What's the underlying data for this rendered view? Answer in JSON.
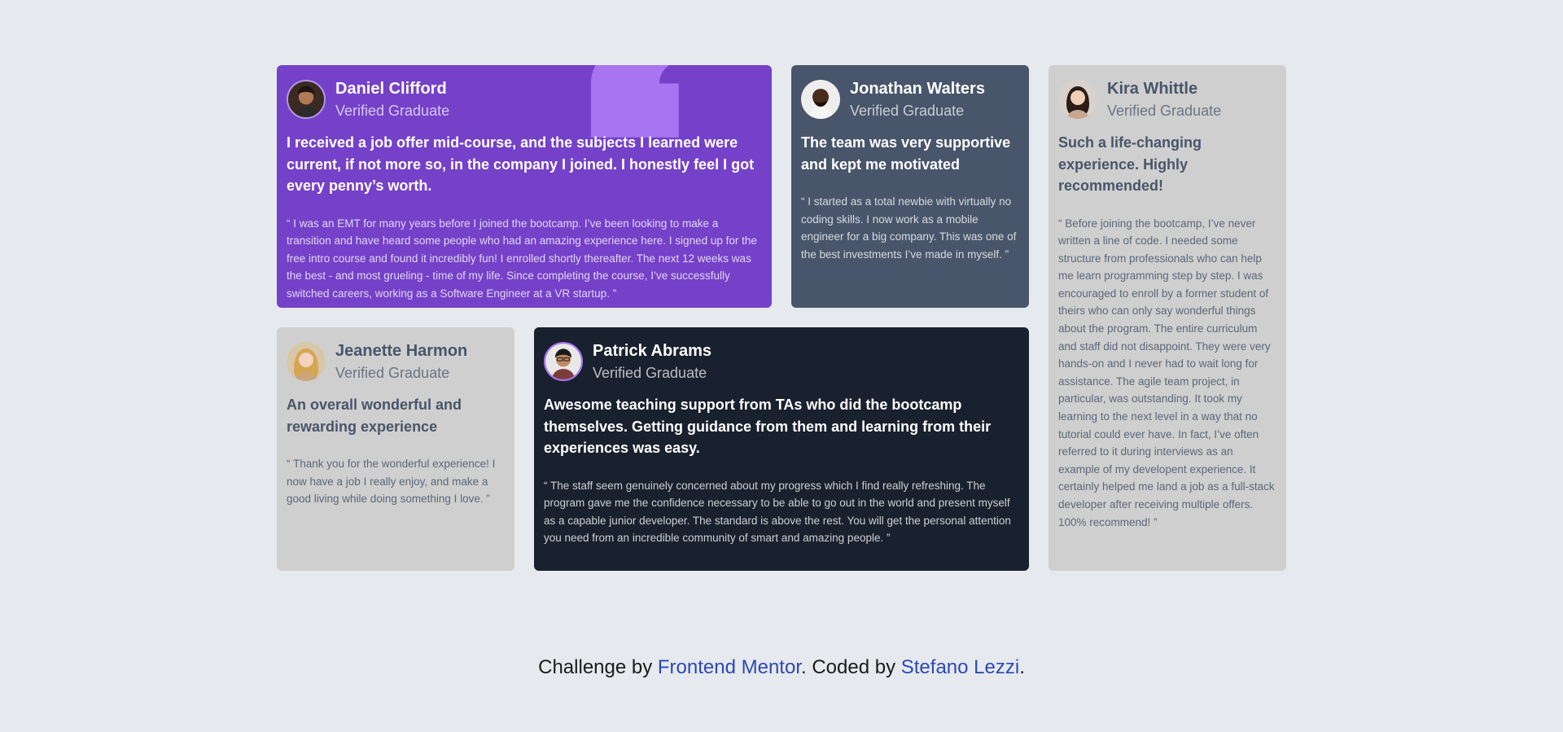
{
  "testimonials": {
    "daniel": {
      "name": "Daniel Clifford",
      "role": "Verified Graduate",
      "headline": "I received a job offer mid-course, and the subjects I learned were current, if not more so, in the company I joined. I honestly feel I got every penny’s worth.",
      "body": "“ I was an EMT for many years before I joined the bootcamp. I’ve been looking to make a transition and have heard some people who had an amazing experience here. I signed up for the free intro course and found it incredibly fun! I enrolled shortly thereafter. The next 12 weeks was the best - and most grueling - time of my life. Since completing the course, I’ve successfully switched careers, working as a Software Engineer at a VR startup. ”"
    },
    "jonathan": {
      "name": "Jonathan Walters",
      "role": "Verified Graduate",
      "headline": "The team was very supportive and kept me motivated",
      "body": "“ I started as a total newbie with virtually no coding skills. I now work as a mobile engineer for a big company. This was one of the best investments I’ve made in myself. ”"
    },
    "kira": {
      "name": "Kira Whittle",
      "role": "Verified Graduate",
      "headline": "Such a life-changing experience. Highly recommended!",
      "body": "“ Before joining the bootcamp, I’ve never written a line of code. I needed some structure from professionals who can help me learn programming step by step. I was encouraged to enroll by a former student of theirs who can only say wonderful things about the program. The entire curriculum and staff did not disappoint. They were very hands-on and I never had to wait long for assistance. The agile team project, in particular, was outstanding. It took my learning to the next level in a way that no tutorial could ever have. In fact, I’ve often referred to it during interviews as an example of my developent experience. It certainly helped me land a job as a full-stack developer after receiving multiple offers. 100% recommend! ”"
    },
    "jeanette": {
      "name": "Jeanette Harmon",
      "role": "Verified Graduate",
      "headline": "An overall wonderful and rewarding experience",
      "body": "“ Thank you for the wonderful experience! I now have a job I really enjoy, and make a good living while doing something I love. ”"
    },
    "patrick": {
      "name": "Patrick Abrams",
      "role": "Verified Graduate",
      "headline": "Awesome teaching support from TAs who did the bootcamp themselves. Getting guidance from them and learning from their experiences was easy.",
      "body": "“ The staff seem genuinely concerned about my progress which I find really refreshing. The program gave me the confidence necessary to be able to go out in the world and present myself as a capable junior developer. The standard is above the rest. You will get the personal attention you need from an incredible community of smart and amazing people. ”"
    }
  },
  "footer": {
    "prefix": "Challenge by ",
    "link1": "Frontend Mentor",
    "middle": ". Coded by ",
    "link2": "Stefano Lezzi",
    "suffix": "."
  },
  "colors": {
    "background": "#e6e9ee",
    "purple": "#7541c8",
    "slate": "#48556a",
    "light_gray": "#cfcfcf",
    "navy": "#19212e",
    "link": "#2c4ab0"
  },
  "icons": {
    "quote": "quotation-mark-icon"
  }
}
